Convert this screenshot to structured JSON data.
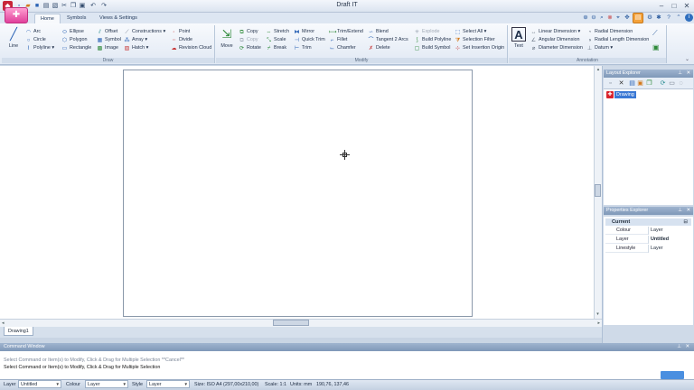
{
  "app": {
    "title": "Draft IT"
  },
  "tabs": [
    "Home",
    "Symbols",
    "Views & Settings"
  ],
  "colors": {
    "accent": "#3a78d4",
    "brand": "#e0409b",
    "titlebar": "#dbe4f0"
  },
  "ribbon": {
    "draw": {
      "label": "Draw",
      "line": "Line",
      "col1": [
        "Arc",
        "Circle",
        "Polyline"
      ],
      "col2": [
        "Ellipse",
        "Polygon",
        "Rectangle"
      ],
      "col3": [
        "Offset",
        "Symbol",
        "Image"
      ],
      "col4": [
        "Constructions",
        "Array",
        "Hatch"
      ],
      "col5": [
        "Point",
        "Divide",
        "Revision Cloud"
      ]
    },
    "modify": {
      "label": "Modify",
      "move": "Move",
      "col1": [
        "Copy",
        "Copy",
        "Rotate"
      ],
      "col2": [
        "Stretch",
        "Scale",
        "Break"
      ],
      "col3": [
        "Mirror",
        "Quick Trim",
        "Trim"
      ],
      "col4": [
        "Trim/Extend",
        "Fillet",
        "Chamfer"
      ],
      "col5": [
        "Blend",
        "Tangent 2 Arcs",
        "Delete"
      ],
      "col6": [
        "Explode",
        "Build Polyline",
        "Build Symbol"
      ],
      "col7": [
        "Select All",
        "Selection Filter",
        "Set Insertion Origin"
      ]
    },
    "annotation": {
      "label": "Annotation",
      "text": "Text",
      "col1": [
        "Linear Dimension",
        "Angular Dimension",
        "Diameter Dimension"
      ],
      "col2": [
        "Radial Dimension",
        "Radial Length Dimension",
        "Datum"
      ]
    }
  },
  "layout_explorer": {
    "title": "Layout Explorer",
    "items": [
      "Drawing"
    ]
  },
  "properties_explorer": {
    "title": "Properties Explorer",
    "section": "Current",
    "rows": [
      {
        "key": "Colour",
        "value": "Layer"
      },
      {
        "key": "Layer",
        "value": "Untitled"
      },
      {
        "key": "Linestyle",
        "value": "Layer"
      }
    ]
  },
  "document_tab": "Drawing1",
  "command_window": {
    "title": "Command Window",
    "lines": [
      "Select Command or Item(s) to Modify, Click & Drag for Multiple Selection  **Cancel**",
      "Select Command or Item(s) to Modify, Click & Drag for Multiple Selection"
    ]
  },
  "status": {
    "layer_label": "Layer",
    "layer_value": "Untitled",
    "colour_label": "Colour",
    "colour_value": "Layer",
    "style_label": "Style",
    "style_value": "Layer",
    "size": "Size: ISO A4 (297,00x210,00)",
    "scale": "Scale: 1:1",
    "units": "Units: mm",
    "coords": "190,76, 137,46"
  }
}
